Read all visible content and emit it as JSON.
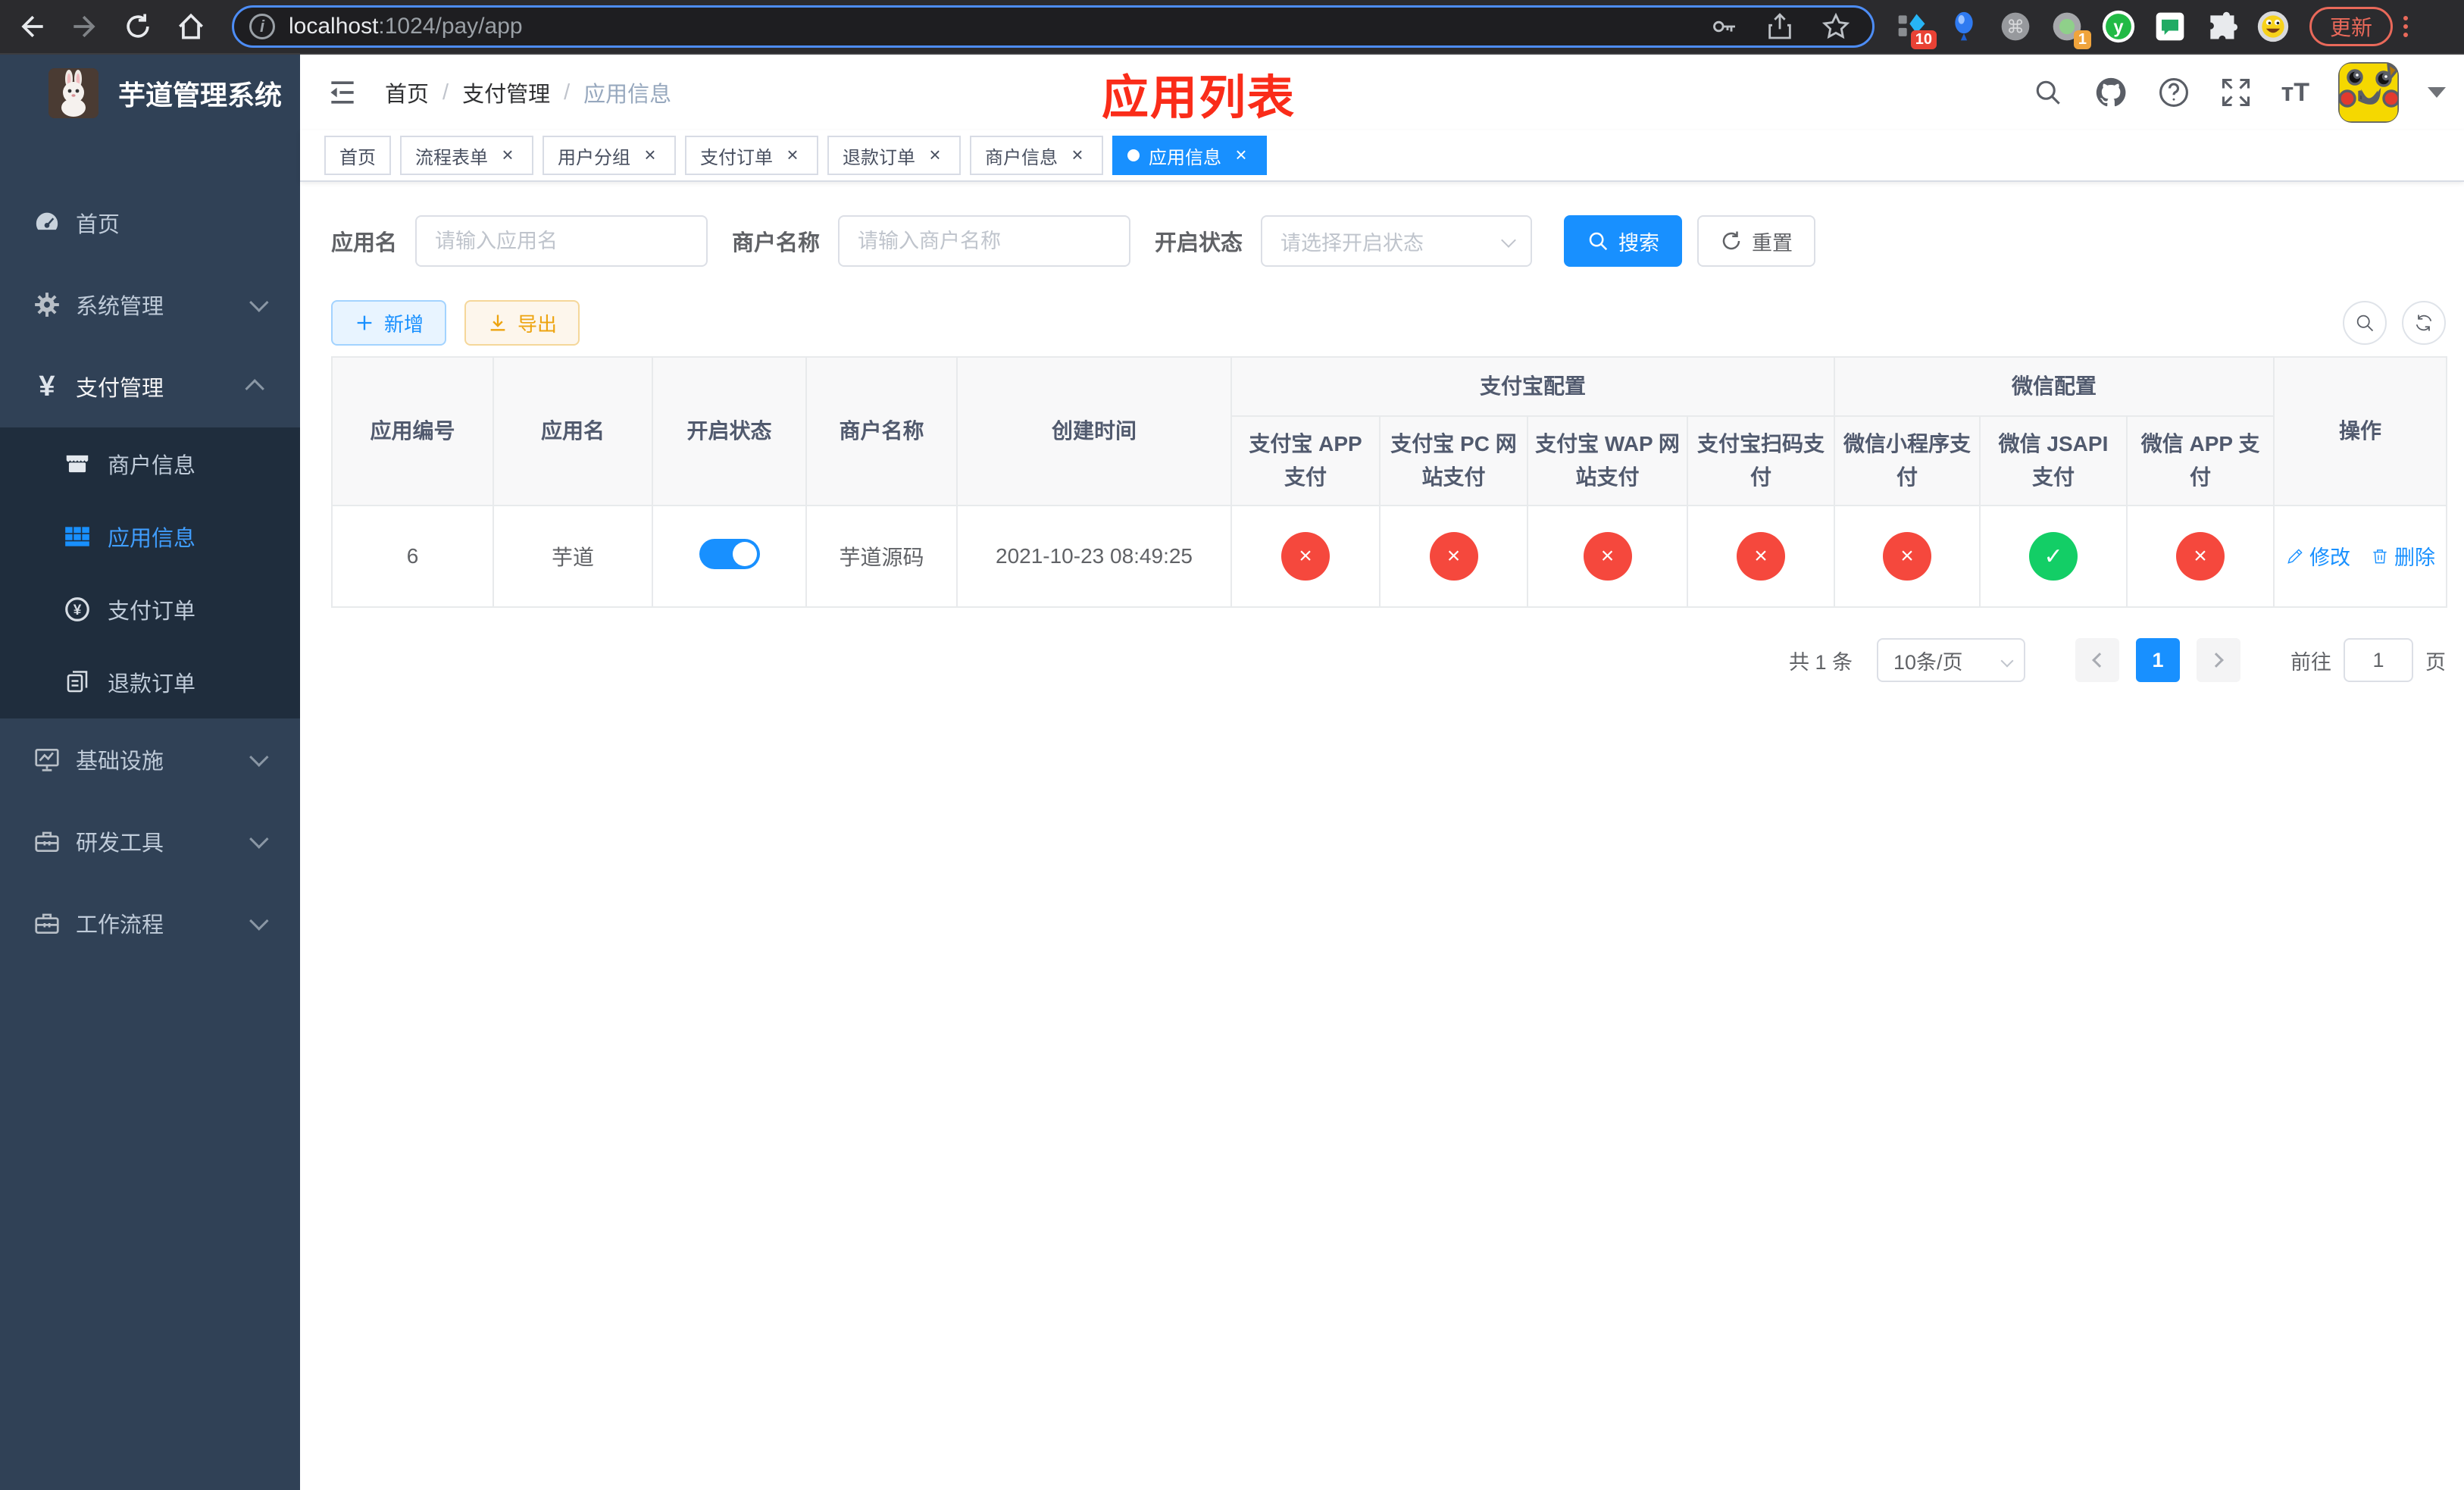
{
  "browser": {
    "url_host": "localhost",
    "url_rest": ":1024/pay/app",
    "update_label": "更新",
    "extension_badge_1": "10",
    "extension_badge_2": "1"
  },
  "sidebar": {
    "title": "芋道管理系统",
    "items": [
      {
        "label": "首页",
        "icon": "dashboard-icon",
        "active": false
      },
      {
        "label": "系统管理",
        "icon": "gear-icon",
        "expandable": true
      },
      {
        "label": "支付管理",
        "icon": "yen-icon",
        "expandable": true,
        "expanded": true
      },
      {
        "label": "商户信息",
        "icon": "shop-icon",
        "active": false
      },
      {
        "label": "应用信息",
        "icon": "grid-icon",
        "active": true
      },
      {
        "label": "支付订单",
        "icon": "yen-circle-icon",
        "active": false
      },
      {
        "label": "退款订单",
        "icon": "documents-icon",
        "active": false
      },
      {
        "label": "基础设施",
        "icon": "monitor-icon",
        "expandable": true
      },
      {
        "label": "研发工具",
        "icon": "toolbox-icon",
        "expandable": true
      },
      {
        "label": "工作流程",
        "icon": "toolbox-icon",
        "expandable": true
      }
    ]
  },
  "header": {
    "breadcrumb": [
      "首页",
      "支付管理",
      "应用信息"
    ]
  },
  "annotation": {
    "text": "应用列表",
    "color": "#fa2c19"
  },
  "tabs": [
    {
      "label": "首页",
      "closable": false,
      "active": false
    },
    {
      "label": "流程表单",
      "closable": true,
      "active": false
    },
    {
      "label": "用户分组",
      "closable": true,
      "active": false
    },
    {
      "label": "支付订单",
      "closable": true,
      "active": false
    },
    {
      "label": "退款订单",
      "closable": true,
      "active": false
    },
    {
      "label": "商户信息",
      "closable": true,
      "active": false
    },
    {
      "label": "应用信息",
      "closable": true,
      "active": true
    }
  ],
  "filters": {
    "app_name_label": "应用名",
    "app_name_placeholder": "请输入应用名",
    "merchant_label": "商户名称",
    "merchant_placeholder": "请输入商户名称",
    "status_label": "开启状态",
    "status_placeholder": "请选择开启状态",
    "search_label": "搜索",
    "reset_label": "重置"
  },
  "toolbar": {
    "add_label": "新增",
    "export_label": "导出"
  },
  "table": {
    "group_headers": {
      "alipay": "支付宝配置",
      "wechat": "微信配置"
    },
    "columns": [
      "应用编号",
      "应用名",
      "开启状态",
      "商户名称",
      "创建时间",
      "支付宝 APP 支付",
      "支付宝 PC 网站支付",
      "支付宝 WAP 网站支付",
      "支付宝扫码支付",
      "微信小程序支付",
      "微信 JSAPI 支付",
      "微信 APP 支付",
      "操作"
    ],
    "rows": [
      {
        "id": "6",
        "name": "芋道",
        "enabled": true,
        "merchant": "芋道源码",
        "created_at": "2021-10-23 08:49:25",
        "configs": [
          false,
          false,
          false,
          false,
          false,
          true,
          false
        ],
        "edit_label": "修改",
        "delete_label": "删除"
      }
    ]
  },
  "pagination": {
    "total": "共 1 条",
    "page_size": "10条/页",
    "current": "1",
    "goto_label": "前往",
    "goto_value": "1",
    "page_suffix": "页"
  },
  "colors": {
    "primary": "#1890ff",
    "sidebar_bg": "#304156",
    "submenu_bg": "#1f2d3d",
    "menu_active": "#409eff",
    "status_off": "#f5483d",
    "status_on": "#13ce66",
    "annotation_red": "#fa2c19",
    "export_accent": "#eda410"
  }
}
